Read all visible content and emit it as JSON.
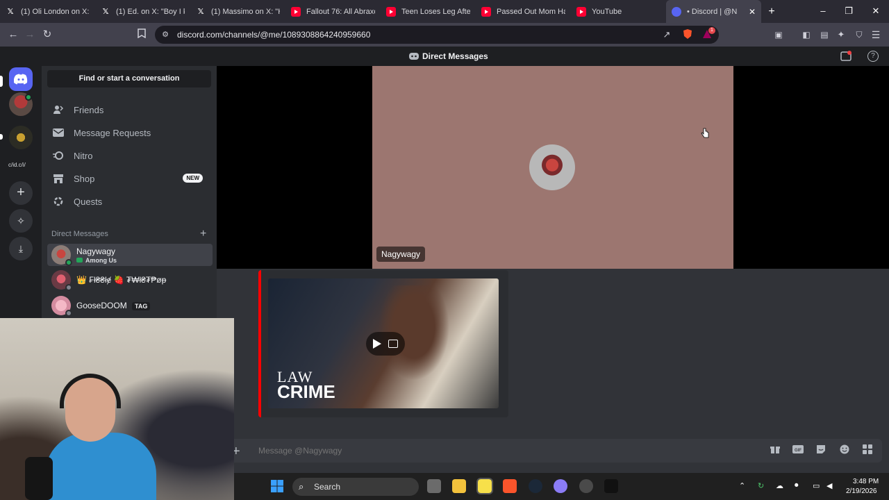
{
  "browser": {
    "tabs": [
      {
        "title": "(1) Oli London on X: \"",
        "icon": "x-logo"
      },
      {
        "title": "(1) Ed. on X: \"Boy I kn",
        "icon": "x-logo"
      },
      {
        "title": "(1) Massimo on X: \"Hy",
        "icon": "x-logo"
      },
      {
        "title": "Fallout 76: All Abraxo",
        "icon": "youtube-logo"
      },
      {
        "title": "Teen Loses Leg After",
        "icon": "youtube-logo"
      },
      {
        "title": "Passed Out Mom Has",
        "icon": "youtube-logo"
      },
      {
        "title": "YouTube",
        "icon": "youtube-logo"
      },
      {
        "title": "• Discord | @N",
        "icon": "discord-logo",
        "active": true
      }
    ],
    "url": "discord.com/channels/@me/1089308864240959660",
    "notification_count": "1"
  },
  "discord": {
    "title": "Direct Messages",
    "find_placeholder": "Find or start a conversation",
    "nav": [
      {
        "label": "Friends",
        "icon": "friends-icon"
      },
      {
        "label": "Message Requests",
        "icon": "mail-icon"
      },
      {
        "label": "Nitro",
        "icon": "nitro-icon"
      },
      {
        "label": "Shop",
        "icon": "shop-icon",
        "badge": "NEW"
      },
      {
        "label": "Quests",
        "icon": "quests-icon"
      }
    ],
    "dm_header": "Direct Messages",
    "dms": [
      {
        "name": "Nagywagy",
        "activity": "Among Us",
        "selected": true
      },
      {
        "name": "👑 ₣ł₴₴łɇ 🍓 ₮₩ł₴₮₱øᵽ",
        "activity": ""
      },
      {
        "name": "GooseDOOM",
        "activity": "",
        "tag": "TAG"
      }
    ],
    "rail_label": "c/id.c/i/",
    "voice_user": "Nagywagy",
    "embed_brand_top": "LAW",
    "embed_brand_bottom": "CRIME",
    "message_placeholder": "Message @Nagywagy",
    "accent": "#5865f2"
  },
  "taskbar": {
    "search_label": "Search",
    "time": "3:48 PM",
    "date": "2/19/2026"
  }
}
